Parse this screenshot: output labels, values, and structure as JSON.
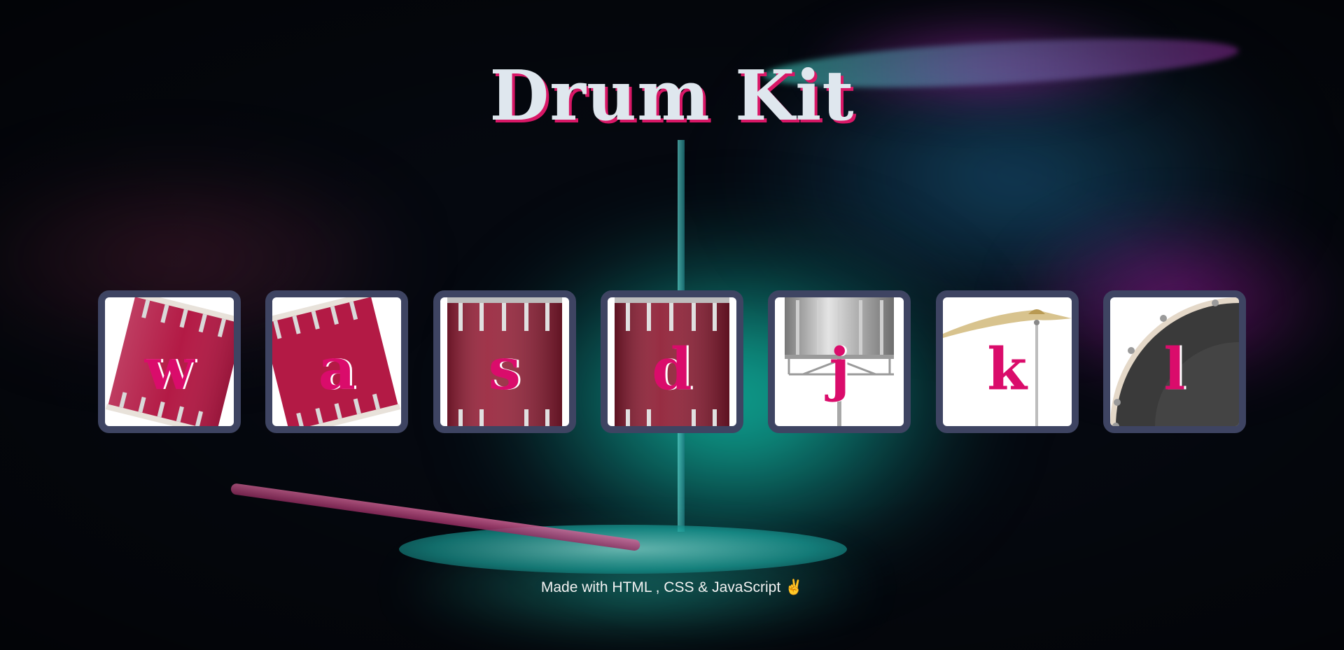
{
  "page": {
    "title": "Drum Kit",
    "footer": "Made with HTML , CSS & JavaScript ✌"
  },
  "colors": {
    "title_shadow": "#d81766",
    "key_border": "#3e4462",
    "letter": "#da0c6b"
  },
  "keys": [
    {
      "letter": "w",
      "icon": "tom-drum-tilted-icon"
    },
    {
      "letter": "a",
      "icon": "tom-drum-tilted-icon"
    },
    {
      "letter": "s",
      "icon": "bass-drum-icon"
    },
    {
      "letter": "d",
      "icon": "bass-drum-icon"
    },
    {
      "letter": "j",
      "icon": "snare-drum-icon"
    },
    {
      "letter": "k",
      "icon": "cymbal-icon"
    },
    {
      "letter": "l",
      "icon": "kick-drum-icon"
    }
  ]
}
